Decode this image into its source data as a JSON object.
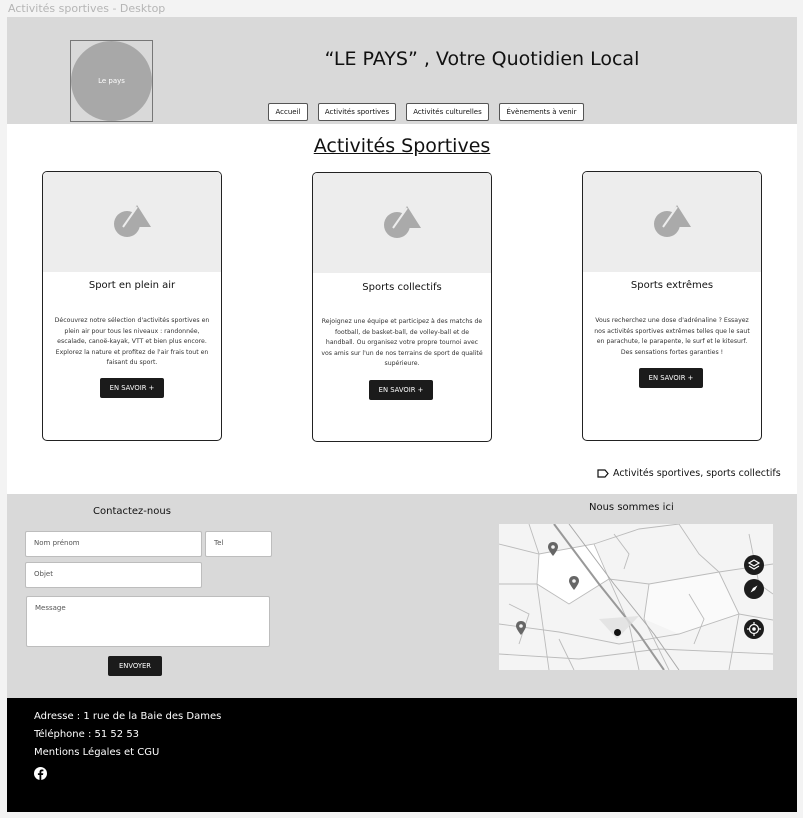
{
  "frame_label": "Activités sportives - Desktop",
  "header": {
    "logo_text": "Le pays",
    "site_title": "“LE PAYS” , Votre Quotidien Local",
    "nav": [
      {
        "label": "Accueil"
      },
      {
        "label": "Activités sportives"
      },
      {
        "label": "Activités culturelles"
      },
      {
        "label": "Évènements à venir"
      }
    ]
  },
  "main": {
    "heading": "Activités Sportives",
    "cards": [
      {
        "title": "Sport en plein air",
        "text": "Découvrez notre sélection d'activités sportives en plein air pour tous les niveaux : randonnée, escalade, canoë-kayak, VTT et bien plus encore. Explorez la nature et profitez de l'air frais tout en faisant du sport.",
        "button": "EN SAVOIR +"
      },
      {
        "title": "Sports collectifs",
        "text": "Rejoignez une équipe et participez à des matchs de football, de basket-ball, de volley-ball et de handball. Ou organisez votre propre tournoi avec vos amis sur l'un de nos terrains de sport de qualité supérieure.",
        "button": "EN SAVOIR +"
      },
      {
        "title": "Sports extrêmes",
        "text": "Vous recherchez une dose d'adrénaline ? Essayez nos activités sportives extrêmes telles que le saut en parachute, le parapente, le surf et le kitesurf. Des sensations fortes garanties !",
        "button": "EN SAVOIR +"
      }
    ],
    "tags": "Activités sportives, sports collectifs"
  },
  "contact": {
    "title": "Contactez-nous",
    "name_placeholder": "Nom prénom",
    "tel_placeholder": "Tel",
    "subject_placeholder": "Objet",
    "message_placeholder": "Message",
    "send_label": "ENVOYER"
  },
  "map": {
    "title": "Nous sommes ici",
    "controls": [
      "layers-icon",
      "compass-icon",
      "locate-icon"
    ]
  },
  "footer": {
    "address": "Adresse : 1 rue de la Baie des Dames",
    "phone": "Téléphone  : 51 52 53",
    "legal": "Mentions Légales et CGU",
    "social_icon": "facebook-icon"
  }
}
